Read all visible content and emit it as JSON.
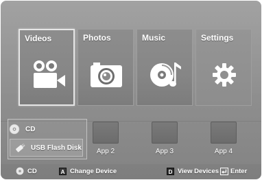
{
  "main_menu": {
    "tiles": [
      {
        "label": "Videos",
        "icon": "video-camera-icon",
        "selected": true
      },
      {
        "label": "Photos",
        "icon": "photo-camera-icon",
        "selected": false
      },
      {
        "label": "Music",
        "icon": "music-disc-icon",
        "selected": false
      },
      {
        "label": "Settings",
        "icon": "gear-icon",
        "selected": false
      }
    ]
  },
  "devices": {
    "items": [
      {
        "label": "CD",
        "icon": "disc-icon"
      },
      {
        "label": "USB Flash Disk",
        "icon": "usb-flash-drive-icon"
      }
    ]
  },
  "apps": [
    {
      "label": "App 2"
    },
    {
      "label": "App 3"
    },
    {
      "label": "App 4"
    }
  ],
  "footer": {
    "current_device": "CD",
    "change_device_key": "A",
    "change_device_label": "Change Device",
    "view_devices_key": "D",
    "view_devices_label": "View Devices",
    "enter_label": "Enter"
  },
  "colors": {
    "background": "#8e8e8e",
    "tile": "#868686",
    "selected_border": "#e6e6e6",
    "text": "#ffffff"
  }
}
